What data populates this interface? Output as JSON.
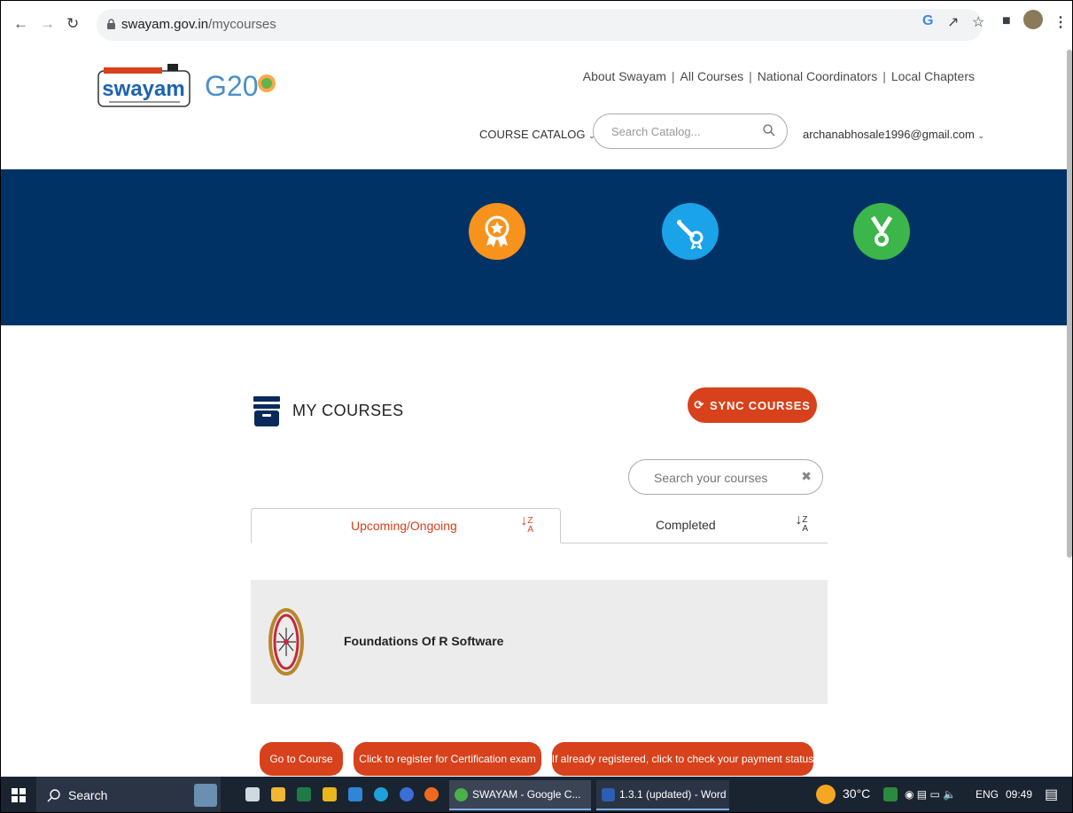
{
  "browser": {
    "url_domain": "swayam.gov.in",
    "url_path": "/mycourses"
  },
  "header": {
    "top_links": [
      "About Swayam",
      "All Courses",
      "National Coordinators",
      "Local Chapters"
    ],
    "catalog_label": "COURSE CATALOG",
    "search_placeholder": "Search Catalog...",
    "user_email": "archanabhosale1996@gmail.com",
    "logo_text": "swayam",
    "g20_text": "G20"
  },
  "banner": {
    "icons": [
      {
        "name": "award-icon",
        "color": "#f7931d"
      },
      {
        "name": "certificate-icon",
        "color": "#1aa3e8"
      },
      {
        "name": "medal-icon",
        "color": "#3cb54a"
      }
    ],
    "background": "#003265"
  },
  "main": {
    "section_title": "MY COURSES",
    "sync_label": "SYNC COURSES",
    "search_placeholder": "Search your courses",
    "tabs": [
      {
        "label": "Upcoming/Ongoing",
        "active": true
      },
      {
        "label": "Completed",
        "active": false
      }
    ],
    "course": {
      "name": "Foundations Of R Software"
    },
    "actions": [
      "Go to Course",
      "Click to register for Certification exam",
      "If already registered, click to check your payment status"
    ],
    "accent": "#d7411b"
  },
  "taskbar": {
    "search_label": "Search",
    "tasks": [
      "SWAYAM - Google C...",
      "1.3.1 (updated) - Word"
    ],
    "temperature": "30°C",
    "language": "ENG",
    "time": "09:49"
  }
}
